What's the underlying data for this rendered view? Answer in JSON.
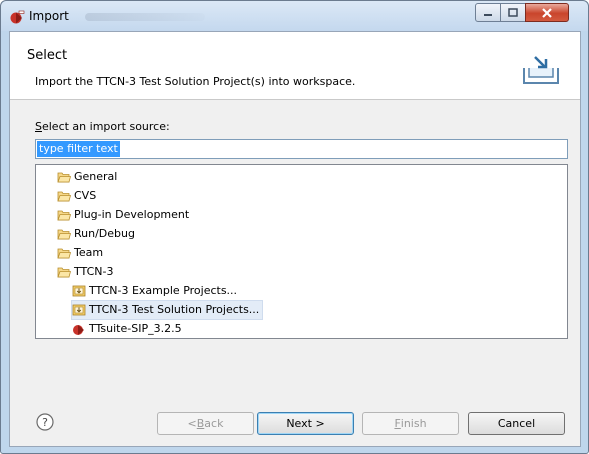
{
  "window": {
    "title": "Import"
  },
  "banner": {
    "title": "Select",
    "description": "Import the TTCN-3 Test Solution Project(s) into workspace."
  },
  "filter": {
    "label_mnemonic": "S",
    "label_rest": "elect an import source:",
    "selected_text": "type filter text"
  },
  "tree": {
    "items": [
      {
        "label": "General",
        "icon": "folder-icon",
        "level": 0
      },
      {
        "label": "CVS",
        "icon": "folder-icon",
        "level": 0
      },
      {
        "label": "Plug-in Development",
        "icon": "folder-icon",
        "level": 0
      },
      {
        "label": "Run/Debug",
        "icon": "folder-icon",
        "level": 0
      },
      {
        "label": "Team",
        "icon": "folder-icon",
        "level": 0
      },
      {
        "label": "TTCN-3",
        "icon": "folder-icon",
        "level": 0
      },
      {
        "label": "TTCN-3 Example Projects...",
        "icon": "import-wizard-icon",
        "level": 1
      },
      {
        "label": "TTCN-3 Test Solution Projects...",
        "icon": "import-wizard-icon",
        "level": 1,
        "selected": true
      },
      {
        "label": "TTsuite-SIP_3.2.5",
        "icon": "ttsuite-icon",
        "level": 1
      }
    ]
  },
  "buttons": {
    "back": {
      "pre": "< ",
      "mnemonic": "B",
      "rest": "ack",
      "enabled": false
    },
    "next": {
      "label": "Next >",
      "enabled": true
    },
    "finish": {
      "mnemonic": "F",
      "rest": "inish",
      "enabled": false
    },
    "cancel": {
      "label": "Cancel",
      "enabled": true
    }
  },
  "icons": {
    "app": "eclipse-import-icon",
    "banner": "import-tray-icon",
    "help": "help-icon"
  },
  "colors": {
    "selection": "#3399ff",
    "title_bar": "#c4d8ee",
    "close_button": "#c9452c"
  }
}
